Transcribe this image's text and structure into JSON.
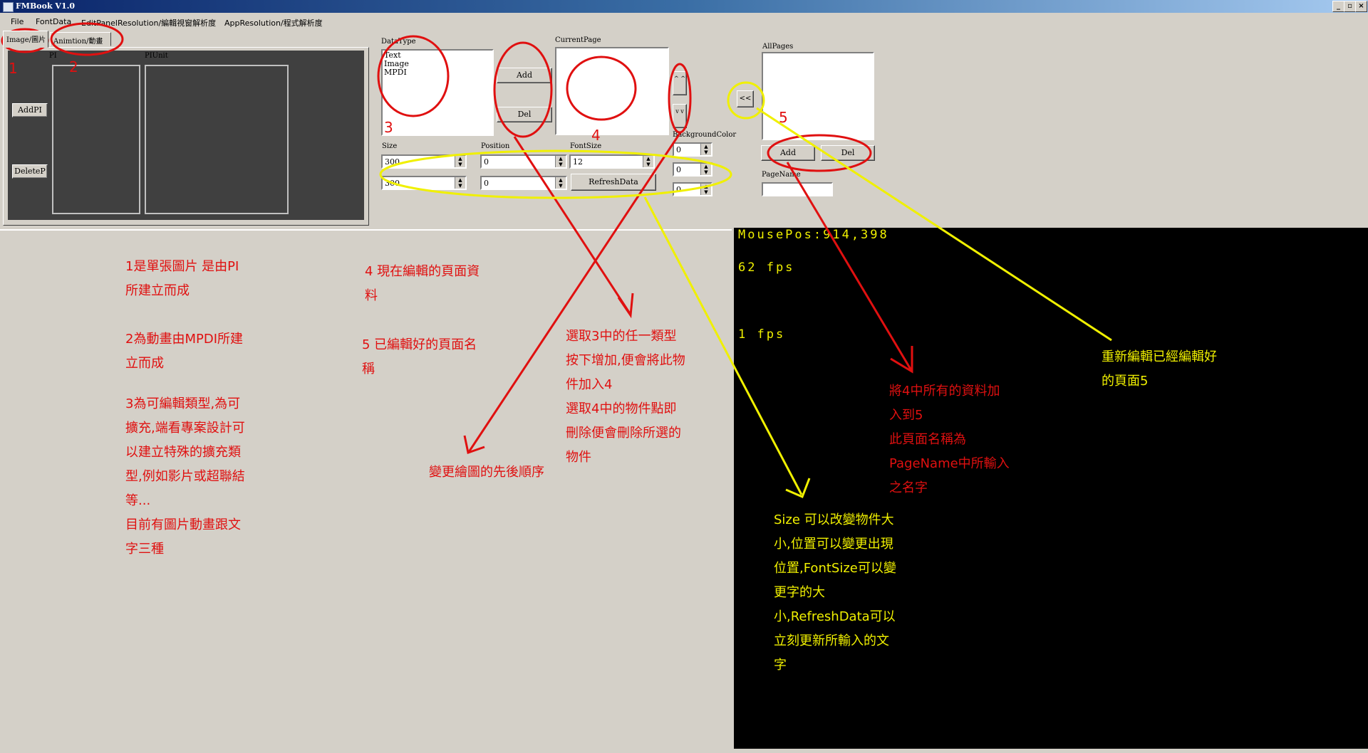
{
  "window": {
    "title": "FMBook V1.0",
    "controls": [
      "_",
      "▫",
      "×"
    ]
  },
  "menu": [
    "File",
    "FontData",
    "EditPanelResolution/編輯視窗解析度",
    "AppResolution/程式解析度"
  ],
  "tabs": [
    {
      "label": "Image/圖片"
    },
    {
      "label": "Animtion/動畫"
    }
  ],
  "image_tab": {
    "pi_label": "PI",
    "piunit_label": "PIUnit",
    "add_pi": "AddPI",
    "delete_p": "DeleteP"
  },
  "datatype": {
    "label": "DataType",
    "items": [
      "Text",
      "Image",
      "MPDI"
    ],
    "add": "Add",
    "del": "Del"
  },
  "currentpage": {
    "label": "CurrentPage",
    "up": "^ ^",
    "down": "v v"
  },
  "size": {
    "label": "Size",
    "width": "300",
    "height": "300"
  },
  "position": {
    "label": "Position",
    "x": "0",
    "y": "0"
  },
  "fontsize": {
    "label": "FontSize",
    "value": "12",
    "refresh": "RefreshData"
  },
  "background_color": {
    "label": "BackgroundColor",
    "r": "0",
    "g": "0",
    "b": "0"
  },
  "allpages": {
    "label": "AllPages",
    "back": "<<",
    "add": "Add",
    "del": "Del",
    "pagename_label": "PageName",
    "pagename_value": ""
  },
  "render": {
    "mousepos": "MousePos:914,398",
    "fps1": "62 fps",
    "fps2": "1 fps"
  },
  "markers": [
    "1",
    "2",
    "3",
    "4",
    "5"
  ],
  "notes": {
    "n1": [
      "1是單張圖片  是由PI",
      "所建立而成"
    ],
    "n2": [
      "2為動畫由MPDI所建",
      "立而成"
    ],
    "n3": [
      "3為可編輯類型,為可",
      "擴充,端看專案設計可",
      "以建立特殊的擴充類",
      "型,例如影片或超聯結",
      "等...",
      "目前有圖片動畫跟文",
      "字三種"
    ],
    "n4": [
      "4 現在編輯的頁面資",
      "料"
    ],
    "n5": [
      "5 已編輯好的頁面名",
      "稱"
    ],
    "add_del": [
      "選取3中的任一類型",
      "按下增加,便會將此物",
      "件加入4",
      "選取4中的物件點即",
      "刪除便會刪除所選的",
      "物件"
    ],
    "order": [
      "變更繪圖的先後順序"
    ],
    "add5": [
      "將4中所有的資料加",
      "入到5",
      "此頁面名稱為",
      "PageName中所輸入",
      "之名字"
    ],
    "reedit": [
      "重新編輯已經編輯好",
      "的頁面5"
    ],
    "size_note": [
      "Size 可以改變物件大",
      "小,位置可以變更出現",
      "位置,FontSize可以變",
      "更字的大",
      "小,RefreshData可以",
      "立刻更新所輸入的文",
      "字"
    ]
  },
  "colors": {
    "annotation_red": "#e01010",
    "annotation_yellow": "#f0f000",
    "render_bg": "#000000"
  }
}
